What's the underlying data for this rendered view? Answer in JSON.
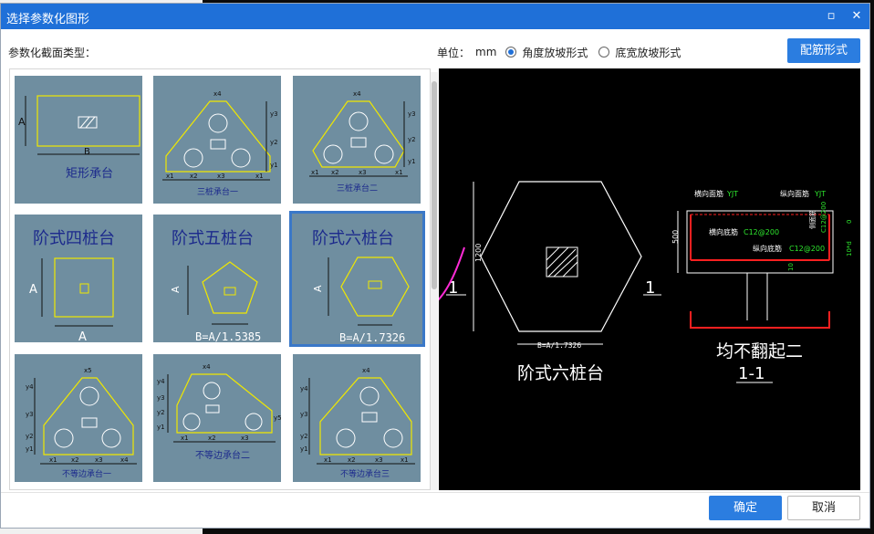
{
  "window": {
    "title": "选择参数化图形"
  },
  "labels": {
    "section_type": "参数化截面类型：",
    "unit_label": "单位：",
    "unit_value": "mm",
    "radio_angle": "角度放坡形式",
    "radio_width": "底宽放坡形式"
  },
  "buttons": {
    "rebar": "配筋形式",
    "ok": "确定",
    "cancel": "取消"
  },
  "radios": {
    "angle_selected": true,
    "width_selected": false
  },
  "tiles": [
    {
      "caption": "矩形承台",
      "dim_a": "A",
      "dim_b": "B"
    },
    {
      "caption": "三桩承台一",
      "dims": [
        "x4",
        "y3",
        "y2",
        "y1",
        "x1",
        "x2",
        "x3",
        "x1"
      ]
    },
    {
      "caption": "三桩承台二",
      "dims": [
        "x4",
        "y3",
        "y2",
        "y1",
        "x1",
        "x2",
        "x3",
        "x1"
      ]
    },
    {
      "caption": "阶式四桩台",
      "dim_a": "A",
      "dim_b": "A"
    },
    {
      "caption": "阶式五桩台",
      "dim_a": "A",
      "formula": "B=A/1.5385"
    },
    {
      "caption": "阶式六桩台",
      "dim_a": "A",
      "formula": "B=A/1.7326"
    },
    {
      "caption": "不等边承台一",
      "dims": [
        "x5",
        "y4",
        "y3",
        "y2",
        "y1",
        "x1",
        "x2",
        "x3",
        "x4"
      ]
    },
    {
      "caption": "不等边承台二",
      "dims": [
        "x4",
        "y4",
        "y3",
        "y2",
        "y1",
        "x1",
        "x2",
        "x3",
        "y5"
      ]
    },
    {
      "caption": "不等边承台三",
      "dims": [
        "x4",
        "y4",
        "y3",
        "y2",
        "y1",
        "x1",
        "x2",
        "x3",
        "x1"
      ]
    }
  ],
  "selected_tile_index": 5,
  "preview": {
    "plan_title": "阶式六桩台",
    "dim_height": "1200",
    "dim_bottom": "B=A/1.7326",
    "section_mark": "1",
    "section_note": "均不翻起二",
    "section_name": "1-1",
    "rebar_labels": {
      "top_transverse": "横向面筋",
      "top_longitudinal": "纵向面筋",
      "bottom_transverse": "横向底筋",
      "bottom_longitudinal": "纵向底筋",
      "side": "侧面筋",
      "rebar_spec": "C12@200",
      "short": "YJT"
    },
    "dim_depth": "500",
    "dim_ten": "10",
    "dim_ten_d": "10*d",
    "dim_zero": "0"
  },
  "colors": {
    "accent": "#1f70d8",
    "tile_bg": "#6f8ea0",
    "shape_yellow": "#f0e800",
    "caption_blue": "#1c2a8c"
  }
}
